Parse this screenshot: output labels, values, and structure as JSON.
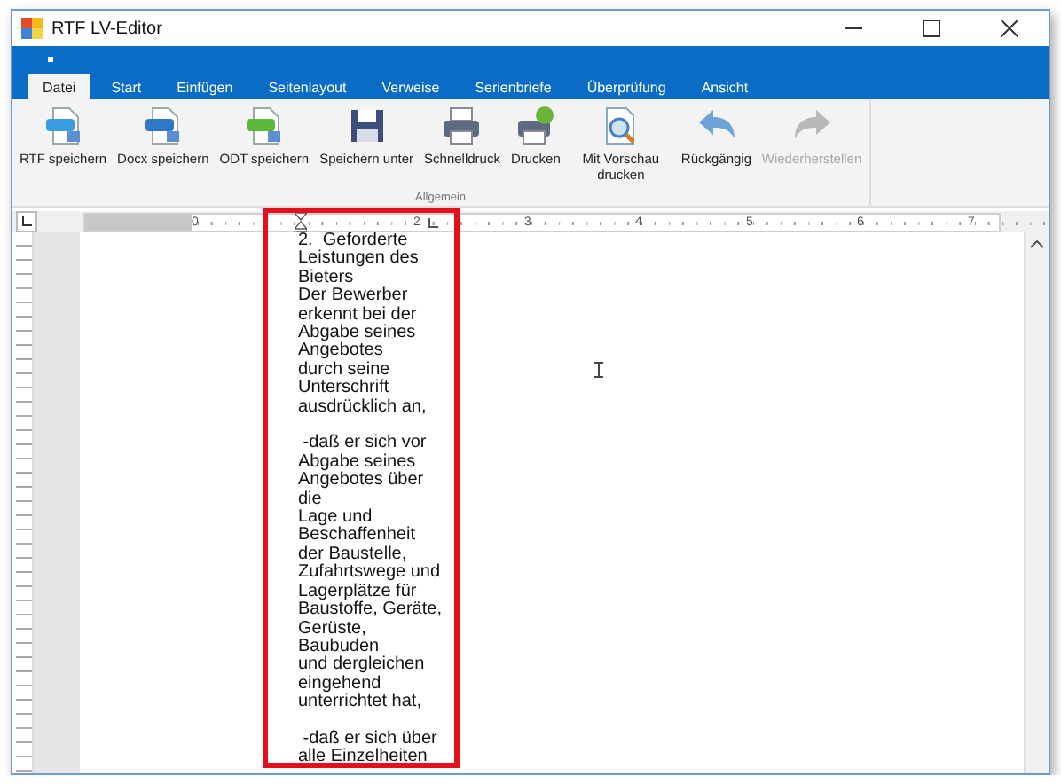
{
  "window": {
    "title": "RTF LV-Editor"
  },
  "tabs": [
    {
      "label": "Datei",
      "selected": true
    },
    {
      "label": "Start",
      "selected": false
    },
    {
      "label": "Einfügen",
      "selected": false
    },
    {
      "label": "Seitenlayout",
      "selected": false
    },
    {
      "label": "Verweise",
      "selected": false
    },
    {
      "label": "Serienbriefe",
      "selected": false
    },
    {
      "label": "Überprüfung",
      "selected": false
    },
    {
      "label": "Ansicht",
      "selected": false
    }
  ],
  "ribbon": {
    "group": "Allgemein",
    "buttons": [
      {
        "label": "RTF speichern",
        "kind": "rtf",
        "disabled": false
      },
      {
        "label": "Docx speichern",
        "kind": "docx",
        "disabled": false
      },
      {
        "label": "ODT speichern",
        "kind": "odt",
        "disabled": false
      },
      {
        "label": "Speichern unter",
        "kind": "save",
        "disabled": false
      },
      {
        "label": "Schnelldruck",
        "kind": "print",
        "disabled": false
      },
      {
        "label": "Drucken",
        "kind": "printdialog",
        "disabled": false
      },
      {
        "label": "Mit Vorschau drucken",
        "kind": "preview",
        "disabled": false
      },
      {
        "label": "Rückgängig",
        "kind": "undo",
        "disabled": false
      },
      {
        "label": "Wiederherstellen",
        "kind": "redo",
        "disabled": true
      }
    ]
  },
  "ruler": {
    "numbers": [
      "0",
      "2",
      "3",
      "4",
      "5",
      "6",
      "7"
    ]
  },
  "document": {
    "paragraphs": [
      [
        "2.  Geforderte",
        "Leistungen des",
        "Bieters",
        "Der Bewerber",
        "erkennt bei der",
        "Abgabe seines",
        "Angebotes",
        "durch seine",
        "Unterschrift",
        "ausdrücklich an,"
      ],
      [
        " -daß er sich vor",
        "Abgabe seines",
        "Angebotes über",
        "die",
        "Lage und",
        "Beschaffenheit",
        "der Baustelle,",
        "Zufahrtswege und",
        "Lagerplätze für",
        "Baustoffe, Geräte,",
        "Gerüste,",
        "Baubuden",
        "und dergleichen",
        "eingehend",
        "unterrichtet hat,"
      ],
      [
        " -daß er sich über",
        "alle Einzelheiten"
      ]
    ]
  }
}
